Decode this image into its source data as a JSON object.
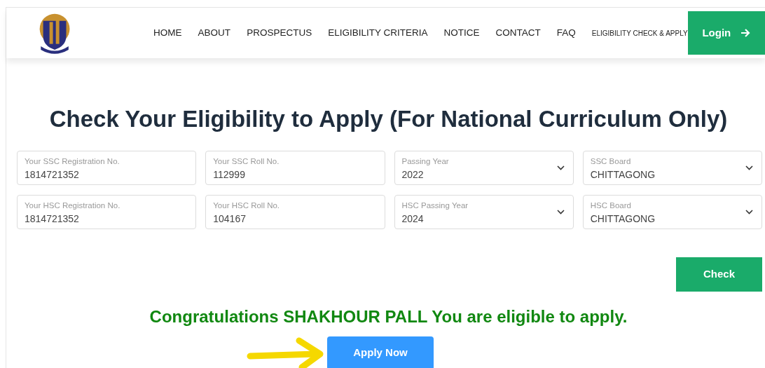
{
  "nav": {
    "items": [
      {
        "label": "HOME"
      },
      {
        "label": "ABOUT"
      },
      {
        "label": "PROSPECTUS"
      },
      {
        "label": "ELIGIBILITY CRITERIA"
      },
      {
        "label": "NOTICE"
      },
      {
        "label": "CONTACT"
      },
      {
        "label": "FAQ"
      },
      {
        "label": "ELIGIBILITY CHECK & APPLY",
        "small": true
      }
    ],
    "login": "Login"
  },
  "title": "Check Your Eligibility to Apply (For National Curriculum Only)",
  "fields": [
    {
      "kind": "input",
      "label": "Your SSC Registration No.",
      "value": "1814721352"
    },
    {
      "kind": "input",
      "label": "Your SSC Roll No.",
      "value": "112999"
    },
    {
      "kind": "select",
      "label": "Passing Year",
      "value": "2022"
    },
    {
      "kind": "select",
      "label": "SSC Board",
      "value": "CHITTAGONG"
    },
    {
      "kind": "input",
      "label": "Your HSC Registration No.",
      "value": "1814721352"
    },
    {
      "kind": "input",
      "label": "Your HSC Roll No.",
      "value": "104167"
    },
    {
      "kind": "select",
      "label": "HSC Passing Year",
      "value": "2024"
    },
    {
      "kind": "select",
      "label": "HSC Board",
      "value": "CHITTAGONG"
    }
  ],
  "check_button": "Check",
  "result": "Congratulations SHAKHOUR PALL You are eligible to apply.",
  "apply_button": "Apply Now"
}
